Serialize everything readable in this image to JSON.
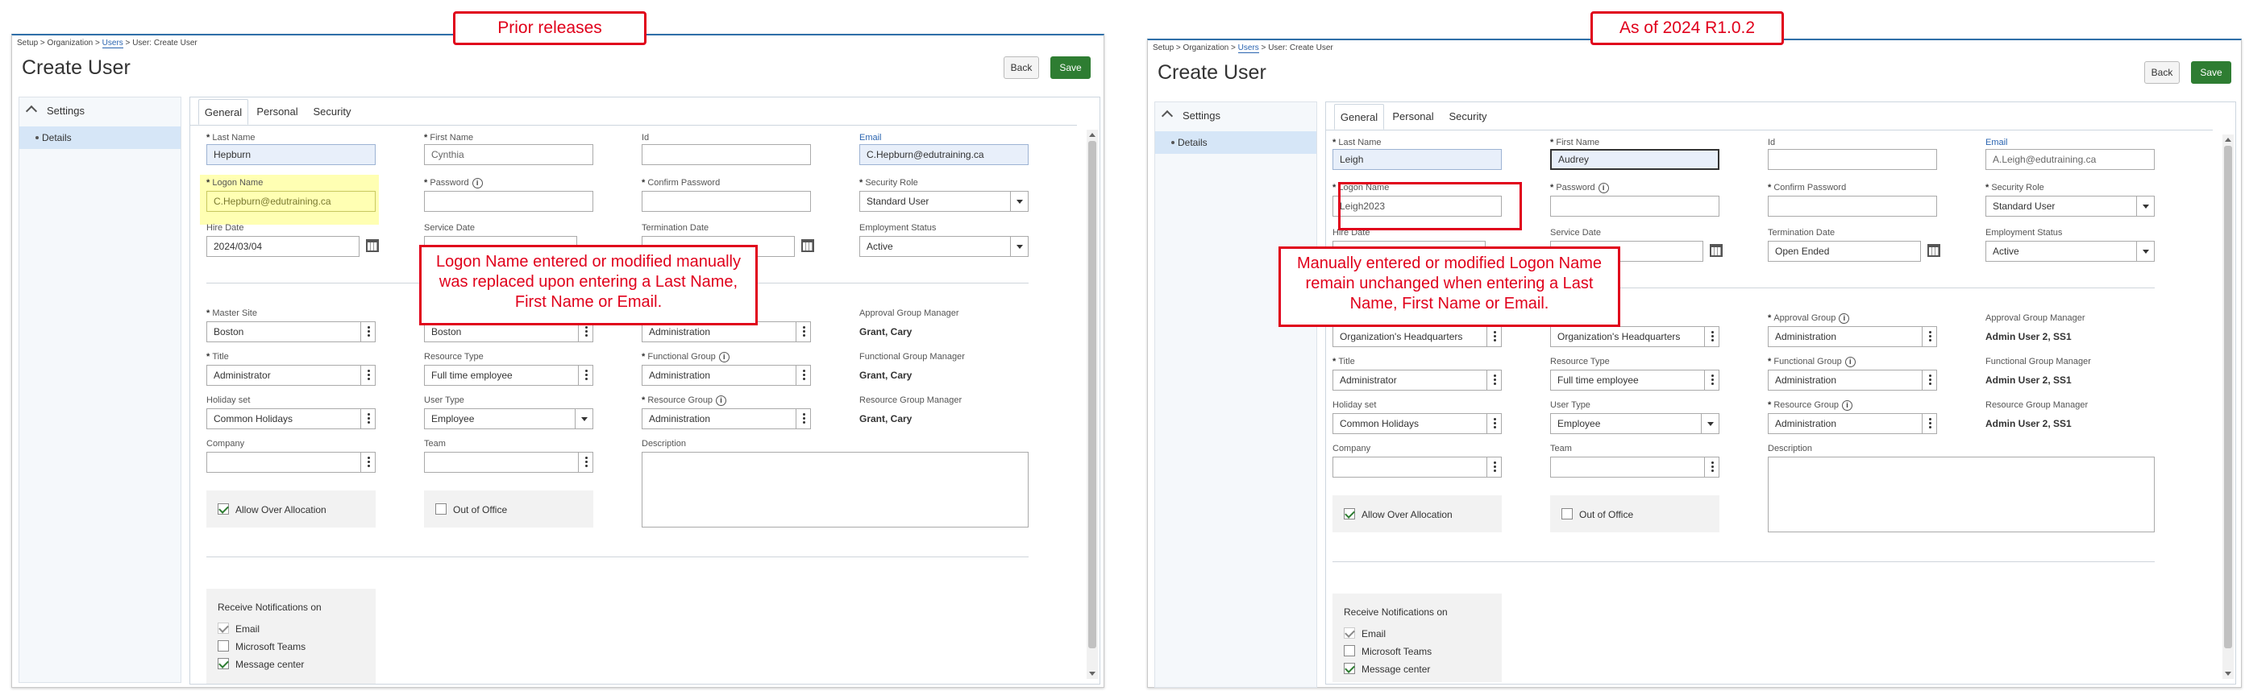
{
  "left": {
    "callout_title": "Prior releases",
    "breadcrumb": {
      "setup": "Setup",
      "org": "Organization",
      "users": "Users",
      "current": "User: Create User"
    },
    "page_title": "Create User",
    "buttons": {
      "back": "Back",
      "save": "Save"
    },
    "sidebar": {
      "header": "Settings",
      "item": "Details"
    },
    "tabs": [
      "General",
      "Personal",
      "Security"
    ],
    "labels": {
      "last_name": "Last Name",
      "first_name": "First Name",
      "id": "Id",
      "email": "Email",
      "logon_name": "Logon Name",
      "password": "Password",
      "confirm_password": "Confirm Password",
      "security_role": "Security Role",
      "hire_date": "Hire Date",
      "service_date": "Service Date",
      "termination_date": "Termination Date",
      "employment_status": "Employment Status",
      "master_site": "Master Site",
      "approval_group_manager": "Approval Group Manager",
      "title": "Title",
      "resource_type": "Resource Type",
      "functional_group": "Functional Group",
      "functional_group_manager": "Functional Group Manager",
      "holiday_set": "Holiday set",
      "user_type": "User Type",
      "resource_group": "Resource Group",
      "resource_group_manager": "Resource Group Manager",
      "company": "Company",
      "team": "Team",
      "description": "Description"
    },
    "values": {
      "last_name": "Hepburn",
      "first_name": "Cynthia",
      "id": "",
      "email": "C.Hepburn@edutraining.ca",
      "logon_name": "C.Hepburn@edutraining.ca",
      "security_role": "Standard User",
      "hire_date": "2024/03/04",
      "employment_status": "Active",
      "master_site": "Boston",
      "site2": "Boston",
      "group1": "Administration",
      "approval_group_manager": "Grant, Cary",
      "title": "Administrator",
      "resource_type": "Full time employee",
      "functional_group": "Administration",
      "functional_group_manager": "Grant, Cary",
      "holiday_set": "Common Holidays",
      "user_type": "Employee",
      "resource_group": "Administration",
      "resource_group_manager": "Grant, Cary"
    },
    "checks": {
      "allow_over": "Allow Over Allocation",
      "out_of_office": "Out of Office"
    },
    "notifications": {
      "title": "Receive Notifications on",
      "email": "Email",
      "teams": "Microsoft Teams",
      "message": "Message center"
    },
    "callout_text": [
      "Logon Name entered or modified manually",
      "was replaced upon entering a Last Name,",
      "First Name or Email."
    ]
  },
  "right": {
    "callout_title": "As of 2024 R1.0.2",
    "breadcrumb": {
      "setup": "Setup",
      "org": "Organization",
      "users": "Users",
      "current": "User: Create User"
    },
    "page_title": "Create User",
    "buttons": {
      "back": "Back",
      "save": "Save"
    },
    "sidebar": {
      "header": "Settings",
      "item": "Details"
    },
    "tabs": [
      "General",
      "Personal",
      "Security"
    ],
    "labels": {
      "last_name": "Last Name",
      "first_name": "First Name",
      "id": "Id",
      "email": "Email",
      "logon_name": "Logon Name",
      "password": "Password",
      "confirm_password": "Confirm Password",
      "security_role": "Security Role",
      "hire_date": "Hire Date",
      "service_date": "Service Date",
      "termination_date": "Termination Date",
      "employment_status": "Employment Status",
      "approval_group": "Approval Group",
      "approval_group_manager": "Approval Group Manager",
      "title": "Title",
      "resource_type": "Resource Type",
      "functional_group": "Functional Group",
      "functional_group_manager": "Functional Group Manager",
      "holiday_set": "Holiday set",
      "user_type": "User Type",
      "resource_group": "Resource Group",
      "resource_group_manager": "Resource Group Manager",
      "company": "Company",
      "team": "Team",
      "description": "Description"
    },
    "values": {
      "last_name": "Leigh",
      "first_name": "Audrey",
      "id": "",
      "email": "A.Leigh@edutraining.ca",
      "logon_name": "Leigh2023",
      "security_role": "Standard User",
      "termination_date": "Open Ended",
      "employment_status": "Active",
      "site1": "Organization's Headquarters",
      "site2": "Organization's Headquarters",
      "approval_group": "Administration",
      "approval_group_manager": "Admin User 2, SS1",
      "title": "Administrator",
      "resource_type": "Full time employee",
      "functional_group": "Administration",
      "functional_group_manager": "Admin User 2, SS1",
      "holiday_set": "Common Holidays",
      "user_type": "Employee",
      "resource_group": "Administration",
      "resource_group_manager": "Admin User 2, SS1"
    },
    "checks": {
      "allow_over": "Allow Over Allocation",
      "out_of_office": "Out of Office"
    },
    "notifications": {
      "title": "Receive Notifications on",
      "email": "Email",
      "teams": "Microsoft Teams",
      "message": "Message center"
    },
    "callout_text": [
      "Manually entered or modified Logon Name",
      "remain unchanged when entering a Last",
      "Name, First Name or Email."
    ]
  }
}
